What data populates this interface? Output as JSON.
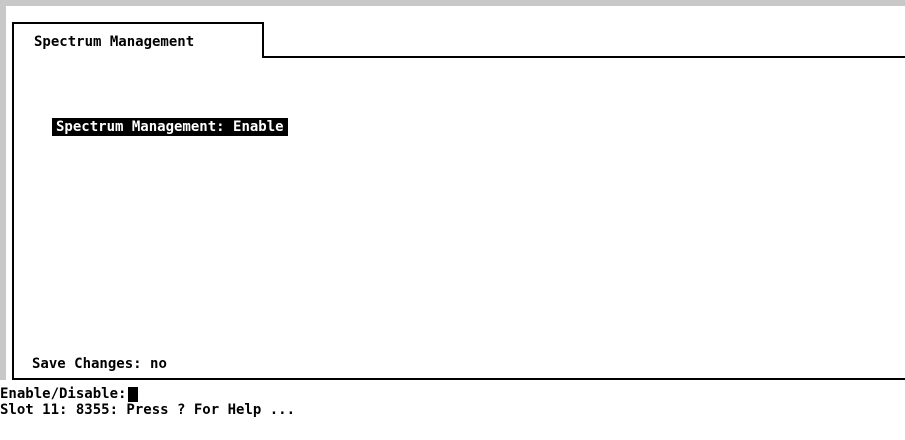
{
  "tab": {
    "label": "Spectrum Management"
  },
  "settings": [
    {
      "label": "Spectrum Management:",
      "value": "Enable"
    }
  ],
  "save": {
    "label": "Save Changes:",
    "value": "no"
  },
  "prompt": {
    "text": "Enable/Disable:"
  },
  "status": {
    "text": "Slot 11: 8355: Press ? For Help ..."
  }
}
